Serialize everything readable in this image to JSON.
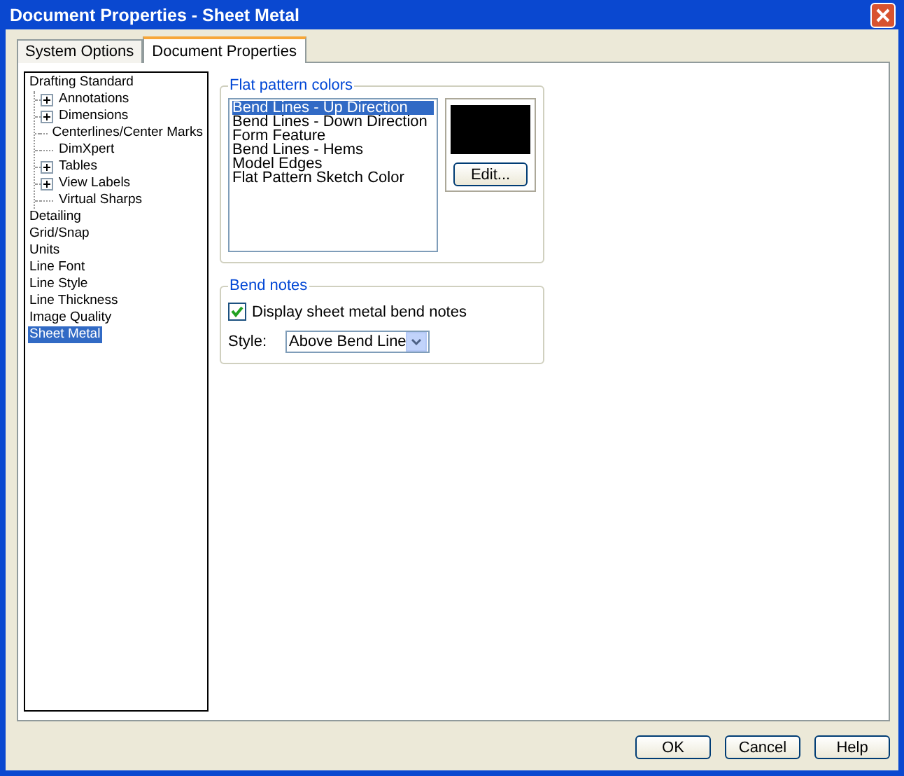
{
  "window": {
    "title": "Document Properties - Sheet Metal"
  },
  "tabs": [
    {
      "label": "System Options",
      "selected": false
    },
    {
      "label": "Document Properties",
      "selected": true
    }
  ],
  "tree": [
    {
      "label": "Drafting Standard",
      "selected": false,
      "children": [
        {
          "label": "Annotations",
          "kind": "folder",
          "expanded": false,
          "selected": false
        },
        {
          "label": "Dimensions",
          "kind": "folder",
          "expanded": false,
          "selected": false
        },
        {
          "label": "Centerlines/Center Marks",
          "kind": "leaf",
          "selected": false
        },
        {
          "label": "DimXpert",
          "kind": "leaf",
          "selected": false
        },
        {
          "label": "Tables",
          "kind": "folder",
          "expanded": false,
          "selected": false
        },
        {
          "label": "View Labels",
          "kind": "folder",
          "expanded": false,
          "selected": false
        },
        {
          "label": "Virtual Sharps",
          "kind": "leaf",
          "selected": false
        }
      ]
    },
    {
      "label": "Detailing",
      "selected": false
    },
    {
      "label": "Grid/Snap",
      "selected": false
    },
    {
      "label": "Units",
      "selected": false
    },
    {
      "label": "Line Font",
      "selected": false
    },
    {
      "label": "Line Style",
      "selected": false
    },
    {
      "label": "Line Thickness",
      "selected": false
    },
    {
      "label": "Image Quality",
      "selected": false
    },
    {
      "label": "Sheet Metal",
      "selected": true
    }
  ],
  "flat_pattern_colors": {
    "title": "Flat pattern colors",
    "items": [
      {
        "label": "Bend Lines - Up Direction",
        "selected": true
      },
      {
        "label": "Bend Lines - Down Direction",
        "selected": false
      },
      {
        "label": "Form Feature",
        "selected": false
      },
      {
        "label": "Bend Lines - Hems",
        "selected": false
      },
      {
        "label": "Model Edges",
        "selected": false
      },
      {
        "label": "Flat Pattern Sketch Color",
        "selected": false
      }
    ],
    "edit_button": "Edit..."
  },
  "bend_notes": {
    "title": "Bend notes",
    "display_checkbox": {
      "label": "Display sheet metal bend notes",
      "checked": true
    },
    "style_label": "Style:",
    "style_value": "Above Bend Line"
  },
  "buttons": [
    "OK",
    "Cancel",
    "Help"
  ]
}
